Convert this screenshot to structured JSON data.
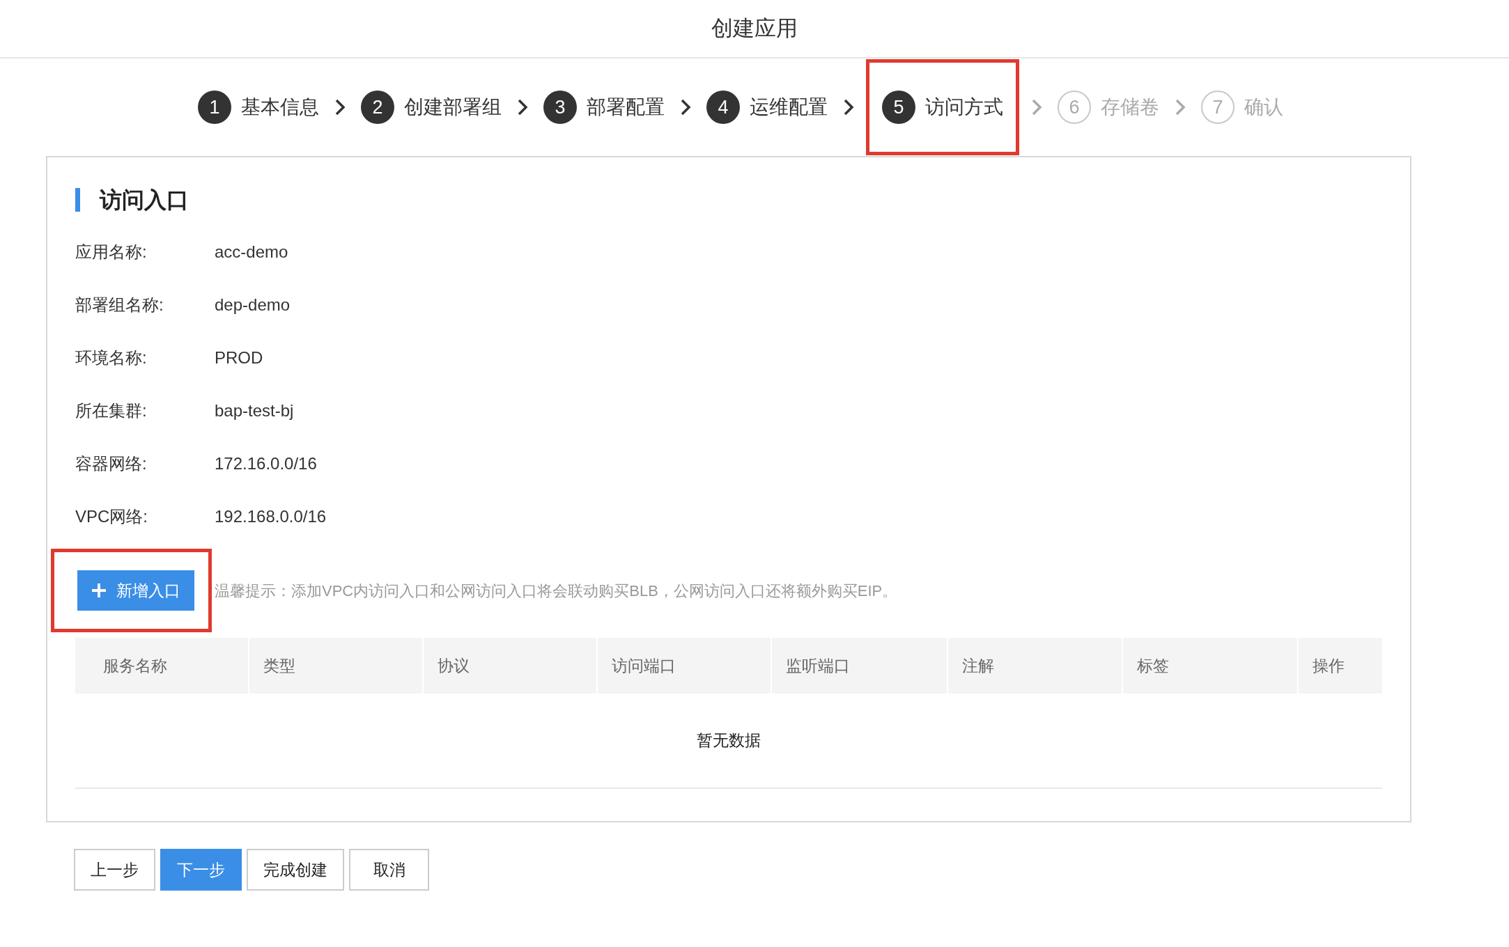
{
  "page_title": "创建应用",
  "steps": [
    {
      "number": "1",
      "label": "基本信息",
      "active": true,
      "highlighted": false
    },
    {
      "number": "2",
      "label": "创建部署组",
      "active": true,
      "highlighted": false
    },
    {
      "number": "3",
      "label": "部署配置",
      "active": true,
      "highlighted": false
    },
    {
      "number": "4",
      "label": "运维配置",
      "active": true,
      "highlighted": false
    },
    {
      "number": "5",
      "label": "访问方式",
      "active": true,
      "highlighted": true
    },
    {
      "number": "6",
      "label": "存储卷",
      "active": false,
      "highlighted": false
    },
    {
      "number": "7",
      "label": "确认",
      "active": false,
      "highlighted": false
    }
  ],
  "section_title": "访问入口",
  "info_rows": [
    {
      "label": "应用名称:",
      "value": "acc-demo"
    },
    {
      "label": "部署组名称:",
      "value": "dep-demo"
    },
    {
      "label": "环境名称:",
      "value": "PROD"
    },
    {
      "label": "所在集群:",
      "value": "bap-test-bj"
    },
    {
      "label": "容器网络:",
      "value": "172.16.0.0/16"
    },
    {
      "label": "VPC网络:",
      "value": "192.168.0.0/16"
    }
  ],
  "add_button": {
    "label": "新增入口",
    "highlighted": true
  },
  "hint": "温馨提示：添加VPC内访问入口和公网访问入口将会联动购买BLB，公网访问入口还将额外购买EIP。",
  "table": {
    "columns": [
      "服务名称",
      "类型",
      "协议",
      "访问端口",
      "监听端口",
      "注解",
      "标签",
      "操作"
    ],
    "empty_text": "暂无数据"
  },
  "footer_buttons": [
    {
      "label": "上一步",
      "primary": false
    },
    {
      "label": "下一步",
      "primary": true
    },
    {
      "label": "完成创建",
      "primary": false
    },
    {
      "label": "取消",
      "primary": false
    }
  ]
}
